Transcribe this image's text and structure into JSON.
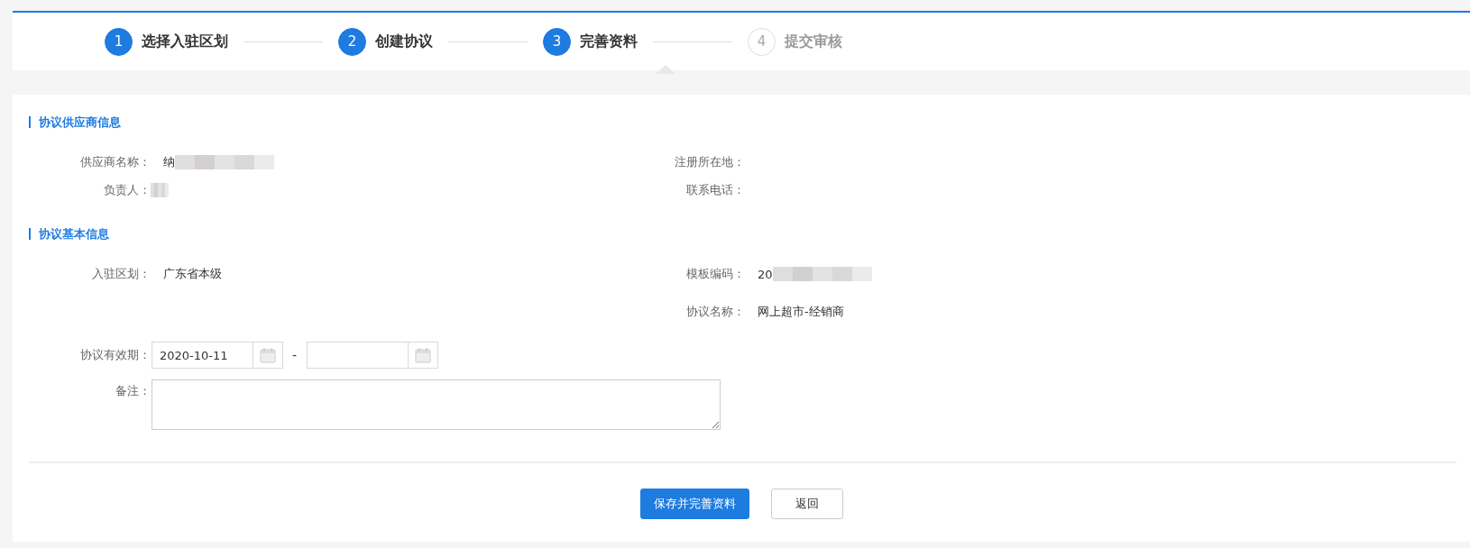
{
  "steps": [
    {
      "number": "1",
      "label": "选择入驻区划",
      "completed": true,
      "selected": false
    },
    {
      "number": "2",
      "label": "创建协议",
      "completed": true,
      "selected": false
    },
    {
      "number": "3",
      "label": "完善资料",
      "completed": true,
      "selected": true
    },
    {
      "number": "4",
      "label": "提交审核",
      "completed": false,
      "selected": false
    }
  ],
  "sections": [
    {
      "title": "协议供应商信息",
      "rows": [
        [
          {
            "label": "供应商名称：",
            "value": "纳",
            "redacted": true
          },
          {
            "label": "注册所在地："
          }
        ],
        [
          {
            "label": "负责人：",
            "redacted": true
          },
          {
            "label": "联系电话："
          }
        ]
      ]
    },
    {
      "title": "协议基本信息",
      "rows": [
        [
          {
            "label": "入驻区划：",
            "value": "广东省本级"
          },
          {
            "label": "模板编码：",
            "value": "20",
            "redacted": true
          }
        ],
        [
          null,
          {
            "label": "协议名称：",
            "value": "网上超市-经销商"
          }
        ]
      ]
    }
  ],
  "validity": {
    "label": "协议有效期：",
    "start": "2020-10-11",
    "separator": "-"
  },
  "remark": {
    "label": "备注："
  },
  "buttons": [
    {
      "label": "保存并完善资料",
      "kind": "primary"
    },
    {
      "label": "返回",
      "kind": "default"
    }
  ]
}
